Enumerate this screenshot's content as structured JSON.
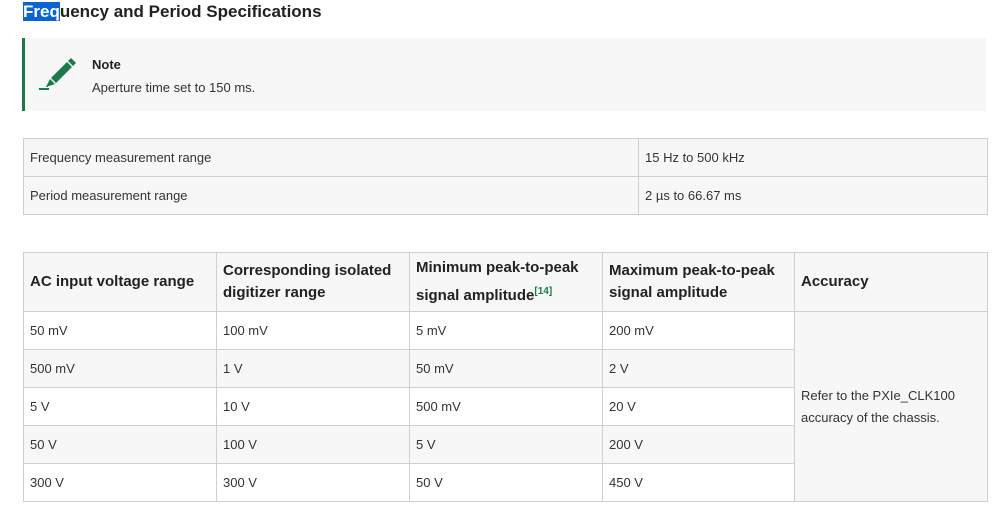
{
  "heading": {
    "selected_part": "Freq",
    "rest": "uency and Period Specifications"
  },
  "note": {
    "icon": "pencil-icon",
    "title": "Note",
    "body": "Aperture time set to 150 ms."
  },
  "measurement_table": {
    "rows": [
      {
        "label": "Frequency measurement range",
        "value": "15 Hz to 500 kHz"
      },
      {
        "label": "Period measurement range",
        "value": "2 µs to 66.67 ms"
      }
    ]
  },
  "spec_table": {
    "headers": {
      "col1": "AC input voltage range",
      "col2": "Corresponding isolated digitizer range",
      "col3": "Minimum peak-to-peak signal amplitude",
      "col3_footnote": "[14]",
      "col4": "Maximum peak-to-peak signal amplitude",
      "col5": "Accuracy"
    },
    "rows": [
      [
        "50 mV",
        "100 mV",
        "5 mV",
        "200 mV"
      ],
      [
        "500 mV",
        "1 V",
        "50 mV",
        "2 V"
      ],
      [
        "5 V",
        "10 V",
        "500 mV",
        "20 V"
      ],
      [
        "50 V",
        "100 V",
        "5 V",
        "200 V"
      ],
      [
        "300 V",
        "300 V",
        "50 V",
        "450 V"
      ]
    ],
    "accuracy_text": "Refer to the PXIe_CLK100 accuracy of the chassis."
  },
  "colors": {
    "accent_green": "#1a7a4a",
    "selection_blue": "#0a64d6"
  }
}
